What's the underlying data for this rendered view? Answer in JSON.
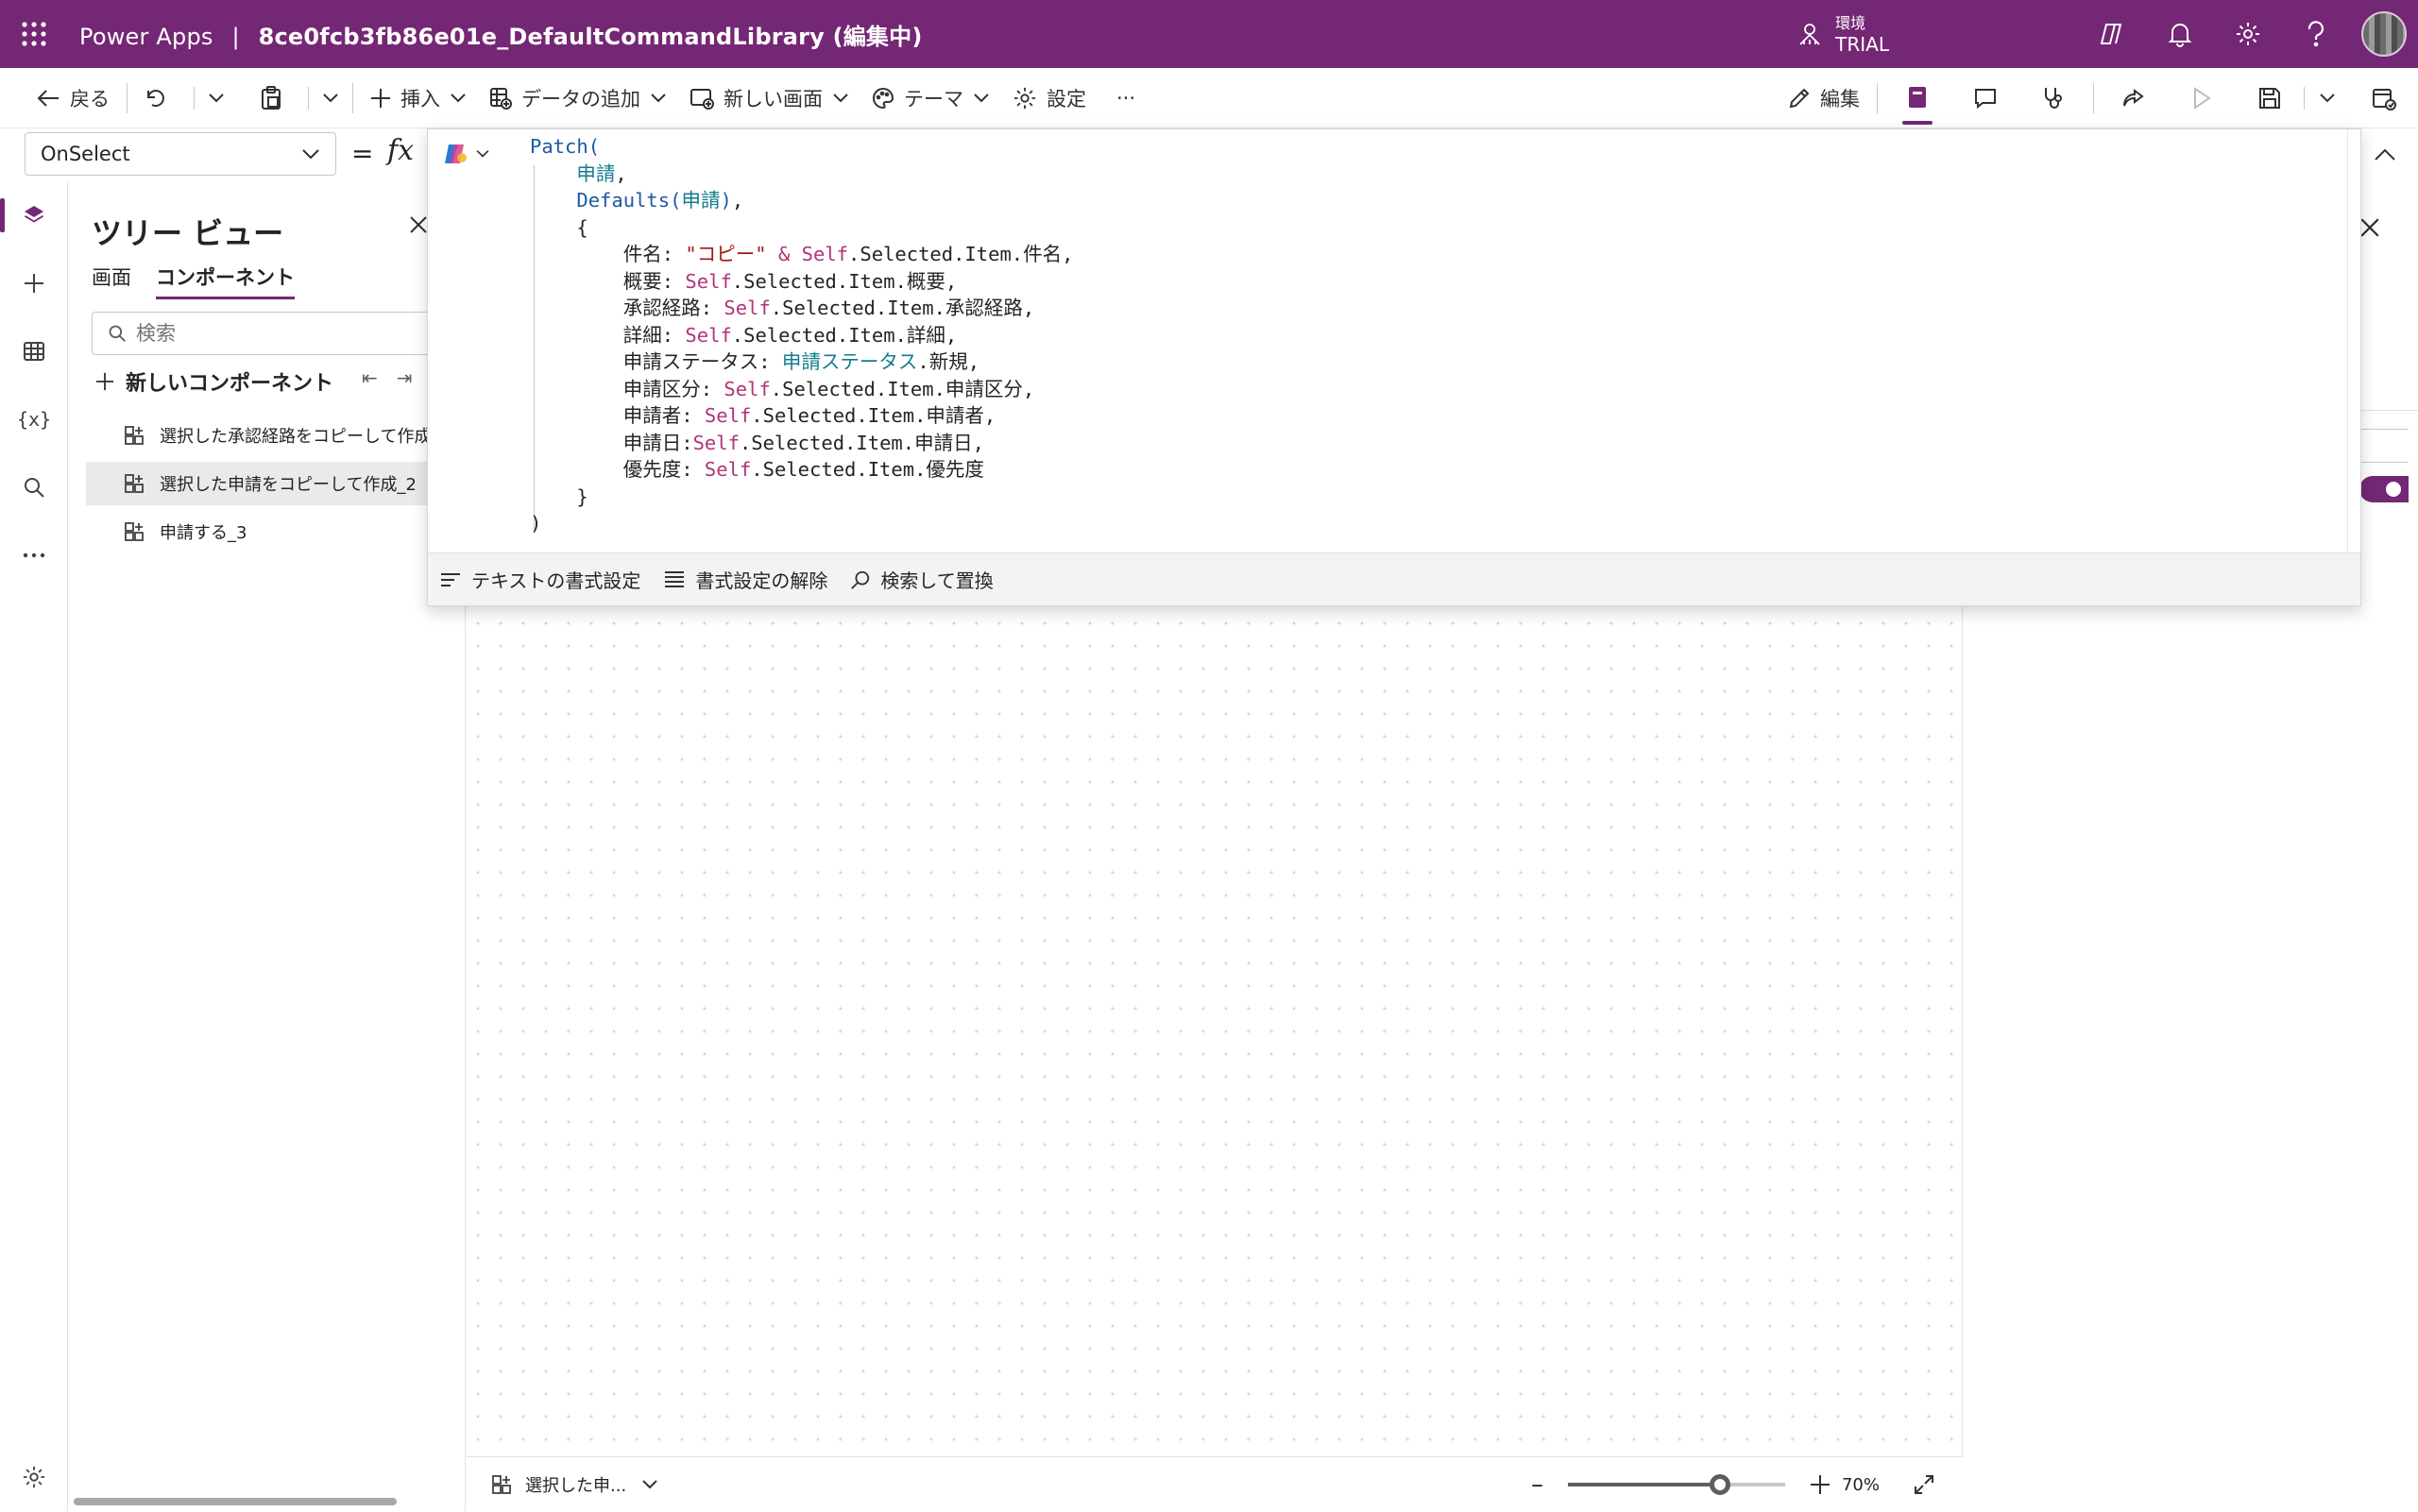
{
  "header": {
    "app_name": "Power Apps",
    "separator": "|",
    "app_file": "8ce0fcb3fb86e01e_DefaultCommandLibrary (編集中)",
    "env_label": "環境",
    "env_value": "TRIAL"
  },
  "toolbar": {
    "back": "戻る",
    "insert": "挿入",
    "add_data": "データの追加",
    "new_screen": "新しい画面",
    "theme": "テーマ",
    "settings": "設定",
    "more": "···",
    "edit": "編集"
  },
  "formula": {
    "property": "OnSelect",
    "equals": "=",
    "fx": "fx"
  },
  "tree": {
    "title": "ツリー ビュー",
    "tabs": [
      "画面",
      "コンポーネント"
    ],
    "search_placeholder": "検索",
    "new_component": "新しいコンポーネント",
    "items": [
      "選択した承認経路をコピーして作成",
      "選択した申請をコピーして作成_2",
      "申請する_3"
    ]
  },
  "editor": {
    "tools": {
      "format_text": "テキストの書式設定",
      "remove_format": "書式設定の解除",
      "find_replace": "検索して置換"
    }
  },
  "status": {
    "screen_name": "選択した申...",
    "zoom_label": "70%",
    "zoom_value": 0.7
  },
  "colors": {
    "brand": "#742774",
    "fn": "#1f58a4",
    "datasource": "#117c8e",
    "self": "#b1337b",
    "string": "#a31515"
  }
}
